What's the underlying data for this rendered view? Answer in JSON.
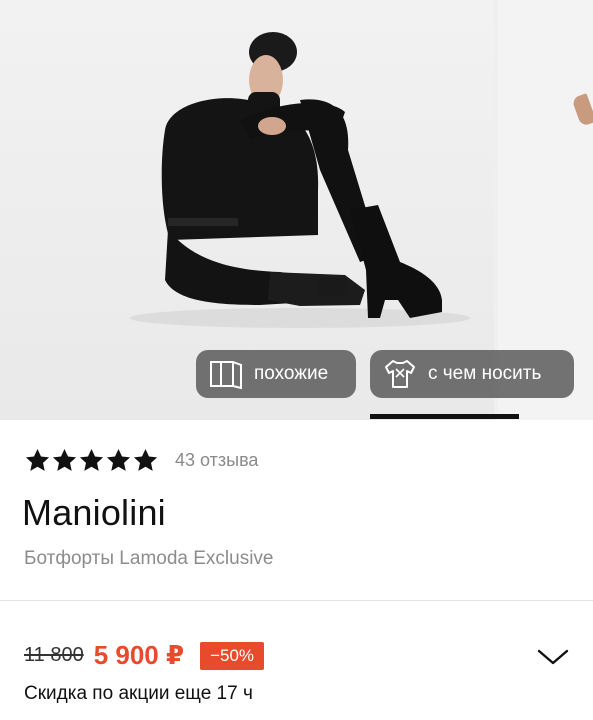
{
  "gallery": {
    "chips": {
      "similar_label": "похожие",
      "outfit_label": "с чем носить"
    },
    "icons": {
      "similar": "similar-items-icon",
      "outfit": "outfit-shirt-icon"
    }
  },
  "product": {
    "rating": {
      "stars": 5,
      "reviews_text": "43 отзыва"
    },
    "brand": "Maniolini",
    "subtitle": "Ботфорты Lamoda Exclusive",
    "price": {
      "old": "11 800",
      "new": "5 900 ₽",
      "discount": "−50%"
    },
    "promo_text": "Скидка по акции еще 17 ч"
  },
  "colors": {
    "accent": "#e74b2b",
    "chip_bg": "#555555",
    "text_muted": "#8a8a8a"
  }
}
